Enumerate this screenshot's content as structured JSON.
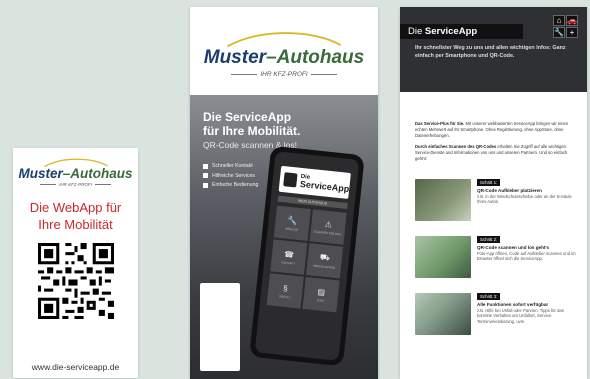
{
  "logo": {
    "brand_part1": "Muster",
    "brand_part2": "–Autohaus",
    "tagline": "IHR KFZ-PROFI"
  },
  "card_small": {
    "title": "Die WebApp für Ihre Mobilität",
    "url": "www.die-serviceapp.de"
  },
  "flyer": {
    "headline_line1": "Die ServiceApp",
    "headline_line2": "für Ihre Mobilität.",
    "subline": "QR-Code scannen & los!",
    "bullets": [
      "Schneller Kontakt",
      "Hilfreiche Services",
      "Einfache Bedienung"
    ],
    "phone": {
      "app_label_small": "Die",
      "app_label_big": "ServiceApp",
      "strip": "MEIN AUTOHAUS",
      "tiles": [
        {
          "icon": "🔧",
          "label": "SERVICE"
        },
        {
          "icon": "⚠",
          "label": "SCHADEN MELDEN"
        },
        {
          "icon": "☎",
          "label": "KONTAKT"
        },
        {
          "icon": "⛟",
          "label": "ABSCHLEPPEN"
        },
        {
          "icon": "§",
          "label": "UNFALL"
        },
        {
          "icon": "▤",
          "label": "INFO"
        }
      ]
    }
  },
  "info": {
    "title_prefix": "Die ",
    "title_bold": "ServiceApp",
    "icons": [
      "⌂",
      "🚗",
      "🔧",
      "+"
    ],
    "intro": "Ihr schnellster Weg zu uns und allen wichtigen Infos: Ganz einfach per Smartphone und QR-Code.",
    "para1_bold": "Das Service-Plus für Sie.",
    "para1": " Mit unserer webbasierten ServiceApp bringen wir einen echten Mehrwert auf Ihr Smartphone. Ohne Registrierung, ohne AppStore, ohne Datenerhebungen.",
    "para2_bold": "Durch einfaches Scannen des QR-Codes",
    "para2": " erhalten Sie Zugriff auf alle wichtigen Service-Dienste und Informationen von uns und unseren Partnern. Und so einfach geht's:",
    "steps": [
      {
        "badge": "Schritt 1:",
        "title": "QR-Code Aufkleber platzieren",
        "text": "z.B. in der Windschutzscheibe oder an der B-Säule Ihres Autos.",
        "color": "#6a7d5c"
      },
      {
        "badge": "Schritt 2:",
        "title": "QR-Code scannen und los geht's",
        "text": "Foto-App öffnen, Code auf Aufkleber scannen und im Browser öffnet sich die ServiceApp.",
        "color": "#7fa07c"
      },
      {
        "badge": "Schritt 3:",
        "title": "Alle Funktionen sofort verfügbar",
        "text": "z.B. Hilfe bei Unfall oder Pannen, Tipps für das korrekte Verhalten am Unfallort, Service-Terminvereinbarung, uvm.",
        "color": "#8aa08c"
      }
    ]
  }
}
